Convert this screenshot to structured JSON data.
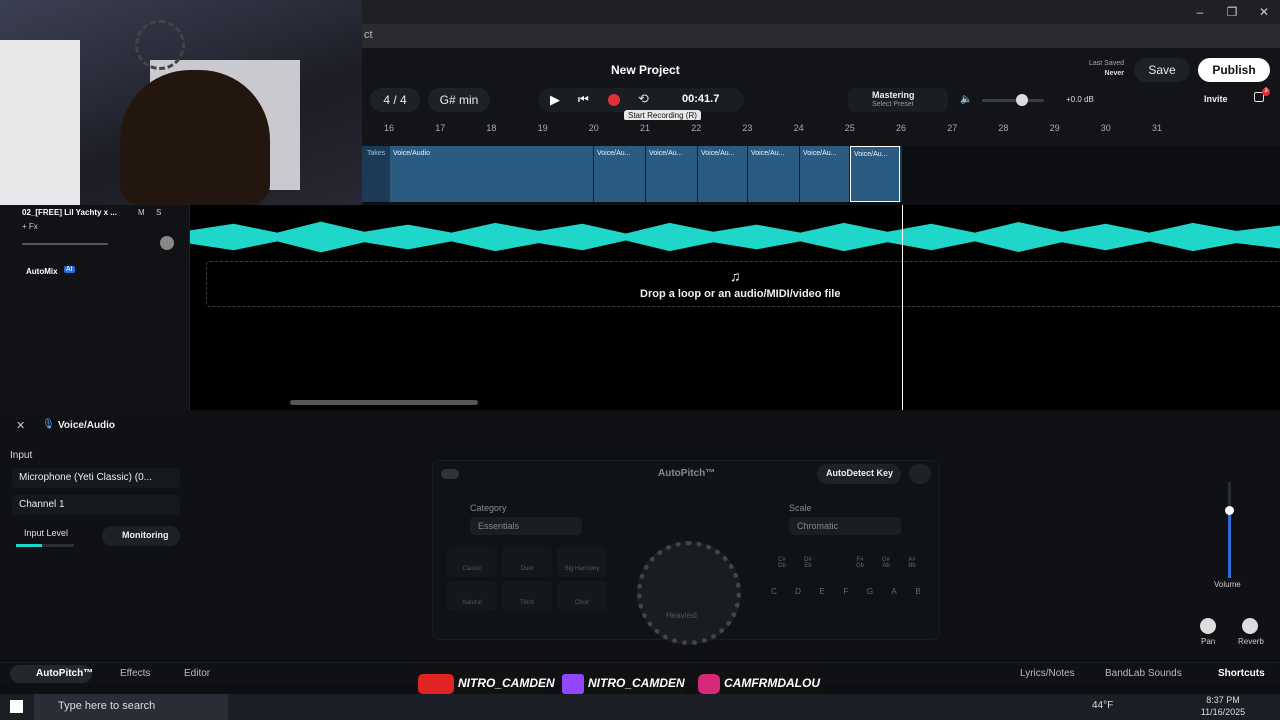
{
  "project": {
    "title": "New Project",
    "last_saved_label": "Last Saved",
    "last_saved_value": "Never"
  },
  "toolbar": {
    "time_sig": "4 / 4",
    "key": "G# min",
    "time": "00:41.7",
    "tooltip": "Start Recording (R)",
    "mastering": "Mastering",
    "mastering_preset": "Select Preset",
    "volume_db": "+0.0 dB",
    "save": "Save",
    "publish": "Publish",
    "invite": "Invite",
    "notif_count": "3"
  },
  "address": {
    "url_fragment": "ct"
  },
  "ruler": {
    "bars": [
      "16",
      "17",
      "18",
      "19",
      "20",
      "21",
      "22",
      "23",
      "24",
      "25",
      "26",
      "27",
      "28",
      "29",
      "30",
      "31"
    ]
  },
  "takes": {
    "label": "Takes",
    "clips": [
      "Voice/Audio",
      "Voice/Au...",
      "Voice/Au...",
      "Voice/Au...",
      "Voice/Au...",
      "Voice/Au...",
      "Voice/Au..."
    ]
  },
  "track": {
    "name": "02_[FREE] Lil Yachty x ...",
    "mute": "M",
    "solo": "S",
    "fx": "+ Fx"
  },
  "automix": {
    "label": "AutoMix",
    "badge": "AI"
  },
  "dropzone": {
    "text": "Drop a loop or an audio/MIDI/video file"
  },
  "panel": {
    "title": "Voice/Audio",
    "input_label": "Input",
    "input_device": "Microphone (Yeti Classic) (0...",
    "channel": "Channel 1",
    "input_level": "Input Level",
    "monitoring": "Monitoring",
    "autopitch": "AutoPitch™",
    "autodetect": "AutoDetect Key",
    "category_label": "Category",
    "category_value": "Essentials",
    "scale_label": "Scale",
    "scale_value": "Chromatic",
    "presets": [
      "Classic",
      "Duet",
      "Big Harmony",
      "Natural",
      "Third",
      "Choir"
    ],
    "knob_label": "Heaviest",
    "sharp_keys": [
      "C#\nDb",
      "D#\nEb",
      "F#\nGb",
      "G#\nAb",
      "A#\nBb"
    ],
    "keys": [
      "C",
      "D",
      "E",
      "F",
      "G",
      "A",
      "B"
    ],
    "volume": "Volume",
    "pan": "Pan",
    "reverb": "Reverb"
  },
  "footer": {
    "autopitch": "AutoPitch™",
    "effects": "Effects",
    "editor": "Editor",
    "lyrics": "Lyrics/Notes",
    "sounds": "BandLab Sounds",
    "shortcuts": "Shortcuts"
  },
  "overlay": {
    "youtube": "NITRO_CAMDEN",
    "twitch": "NITRO_CAMDEN",
    "instagram": "CAMFRMDALOU"
  },
  "taskbar": {
    "search": "Type here to search",
    "weather": "44°F",
    "time": "8:37 PM",
    "date": "11/16/2025"
  },
  "colors": {
    "accent": "#1ed7c8",
    "clip": "#2b5b80",
    "record": "#e0313b",
    "publish_bg": "#ffffff"
  }
}
